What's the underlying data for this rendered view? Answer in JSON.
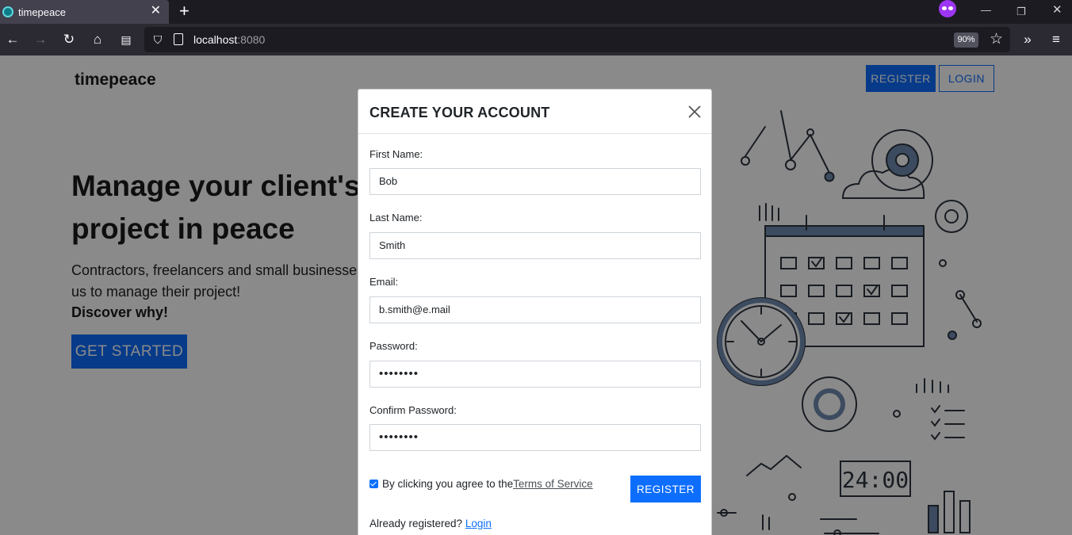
{
  "browser": {
    "tab_title": "timepeace",
    "url_host": "localhost",
    "url_port": ":8080",
    "zoom": "90%"
  },
  "site": {
    "brand": "timepeace",
    "nav_register": "REGISTER",
    "nav_login": "LOGIN"
  },
  "hero": {
    "title": "Manage your client's project in peace",
    "text": "Contractors, freelancers and small businesses us to manage their project!",
    "strong": "Discover why!",
    "cta": "GET STARTED"
  },
  "illustration": {
    "clock_display": "24:00"
  },
  "modal": {
    "title": "CREATE YOUR ACCOUNT",
    "fields": [
      {
        "label": "First Name:",
        "value": "Bob"
      },
      {
        "label": "Last Name:",
        "value": "Smith"
      },
      {
        "label": "Email:",
        "value": "b.smith@e.mail"
      },
      {
        "label": "Password:",
        "value": "••••••••"
      },
      {
        "label": "Confirm Password:",
        "value": "••••••••"
      }
    ],
    "terms_text": "By clicking you agree to the ",
    "terms_link": "Terms of Service",
    "terms_checked": true,
    "register_label": "REGISTER",
    "already_text": "Already registered? ",
    "login_link": "Login"
  },
  "colors": {
    "primary": "#0d6efd",
    "chrome_dark": "#1c1b22",
    "chrome_toolbar": "#2b2a33"
  }
}
